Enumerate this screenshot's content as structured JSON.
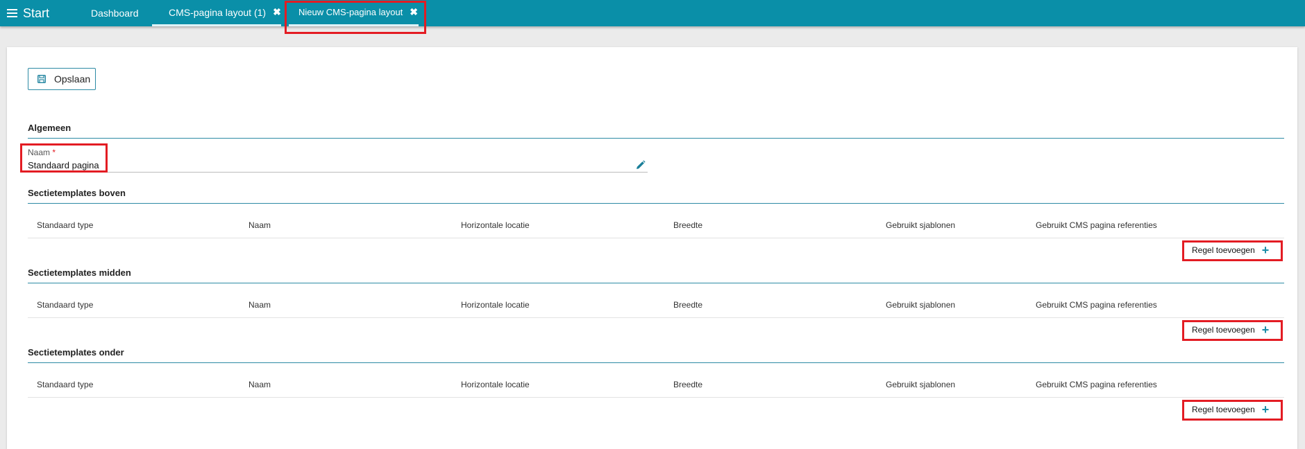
{
  "topbar": {
    "menu_label": "Start",
    "tabs": [
      {
        "label": "Dashboard"
      },
      {
        "label": "CMS-pagina layout (1)",
        "close": "✖"
      },
      {
        "label": "Nieuw CMS-pagina layout",
        "close": "✖"
      }
    ]
  },
  "toolbar": {
    "save_label": "Opslaan"
  },
  "general": {
    "title": "Algemeen",
    "name_label": "Naam",
    "name_required": "*",
    "name_value": "Standaard pagina"
  },
  "columns": [
    "Standaard type",
    "Naam",
    "Horizontale locatie",
    "Breedte",
    "Gebruikt sjablonen",
    "Gebruikt CMS pagina referenties"
  ],
  "sections": [
    {
      "title": "Sectietemplates boven",
      "add_label": "Regel toevoegen"
    },
    {
      "title": "Sectietemplates midden",
      "add_label": "Regel toevoegen"
    },
    {
      "title": "Sectietemplates onder",
      "add_label": "Regel toevoegen"
    }
  ],
  "colors": {
    "accent": "#0a8fa8",
    "highlight": "#e31c23"
  }
}
